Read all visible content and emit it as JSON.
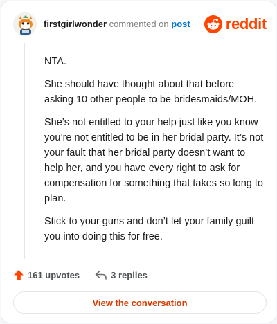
{
  "comment": {
    "username": "firstgirlwonder",
    "action_text": "commented on",
    "post_link": "post",
    "paragraphs": [
      "NTA.",
      "She should have thought about that before asking 10 other people to be bridesmaids/MOH.",
      "She’s not entitled to your help just like you know you’re not entitled to be in her bridal party. It’s not your fault that her bridal party doesn’t want to help her, and you have every right to ask for compensation for something that takes so long to plan.",
      "Stick to your guns and don’t let your family guilt you into doing this for free."
    ]
  },
  "brand": {
    "wordmark": "reddit",
    "icon": "reddit-snoo-icon",
    "color": "#ff4500"
  },
  "actions": {
    "upvotes_label": "161 upvotes",
    "replies_label": "3 replies",
    "upvote_icon": "upvote-arrow-icon",
    "reply_icon": "reply-arrow-icon"
  },
  "cta": {
    "label": "View the conversation",
    "color": "#d93a00"
  }
}
